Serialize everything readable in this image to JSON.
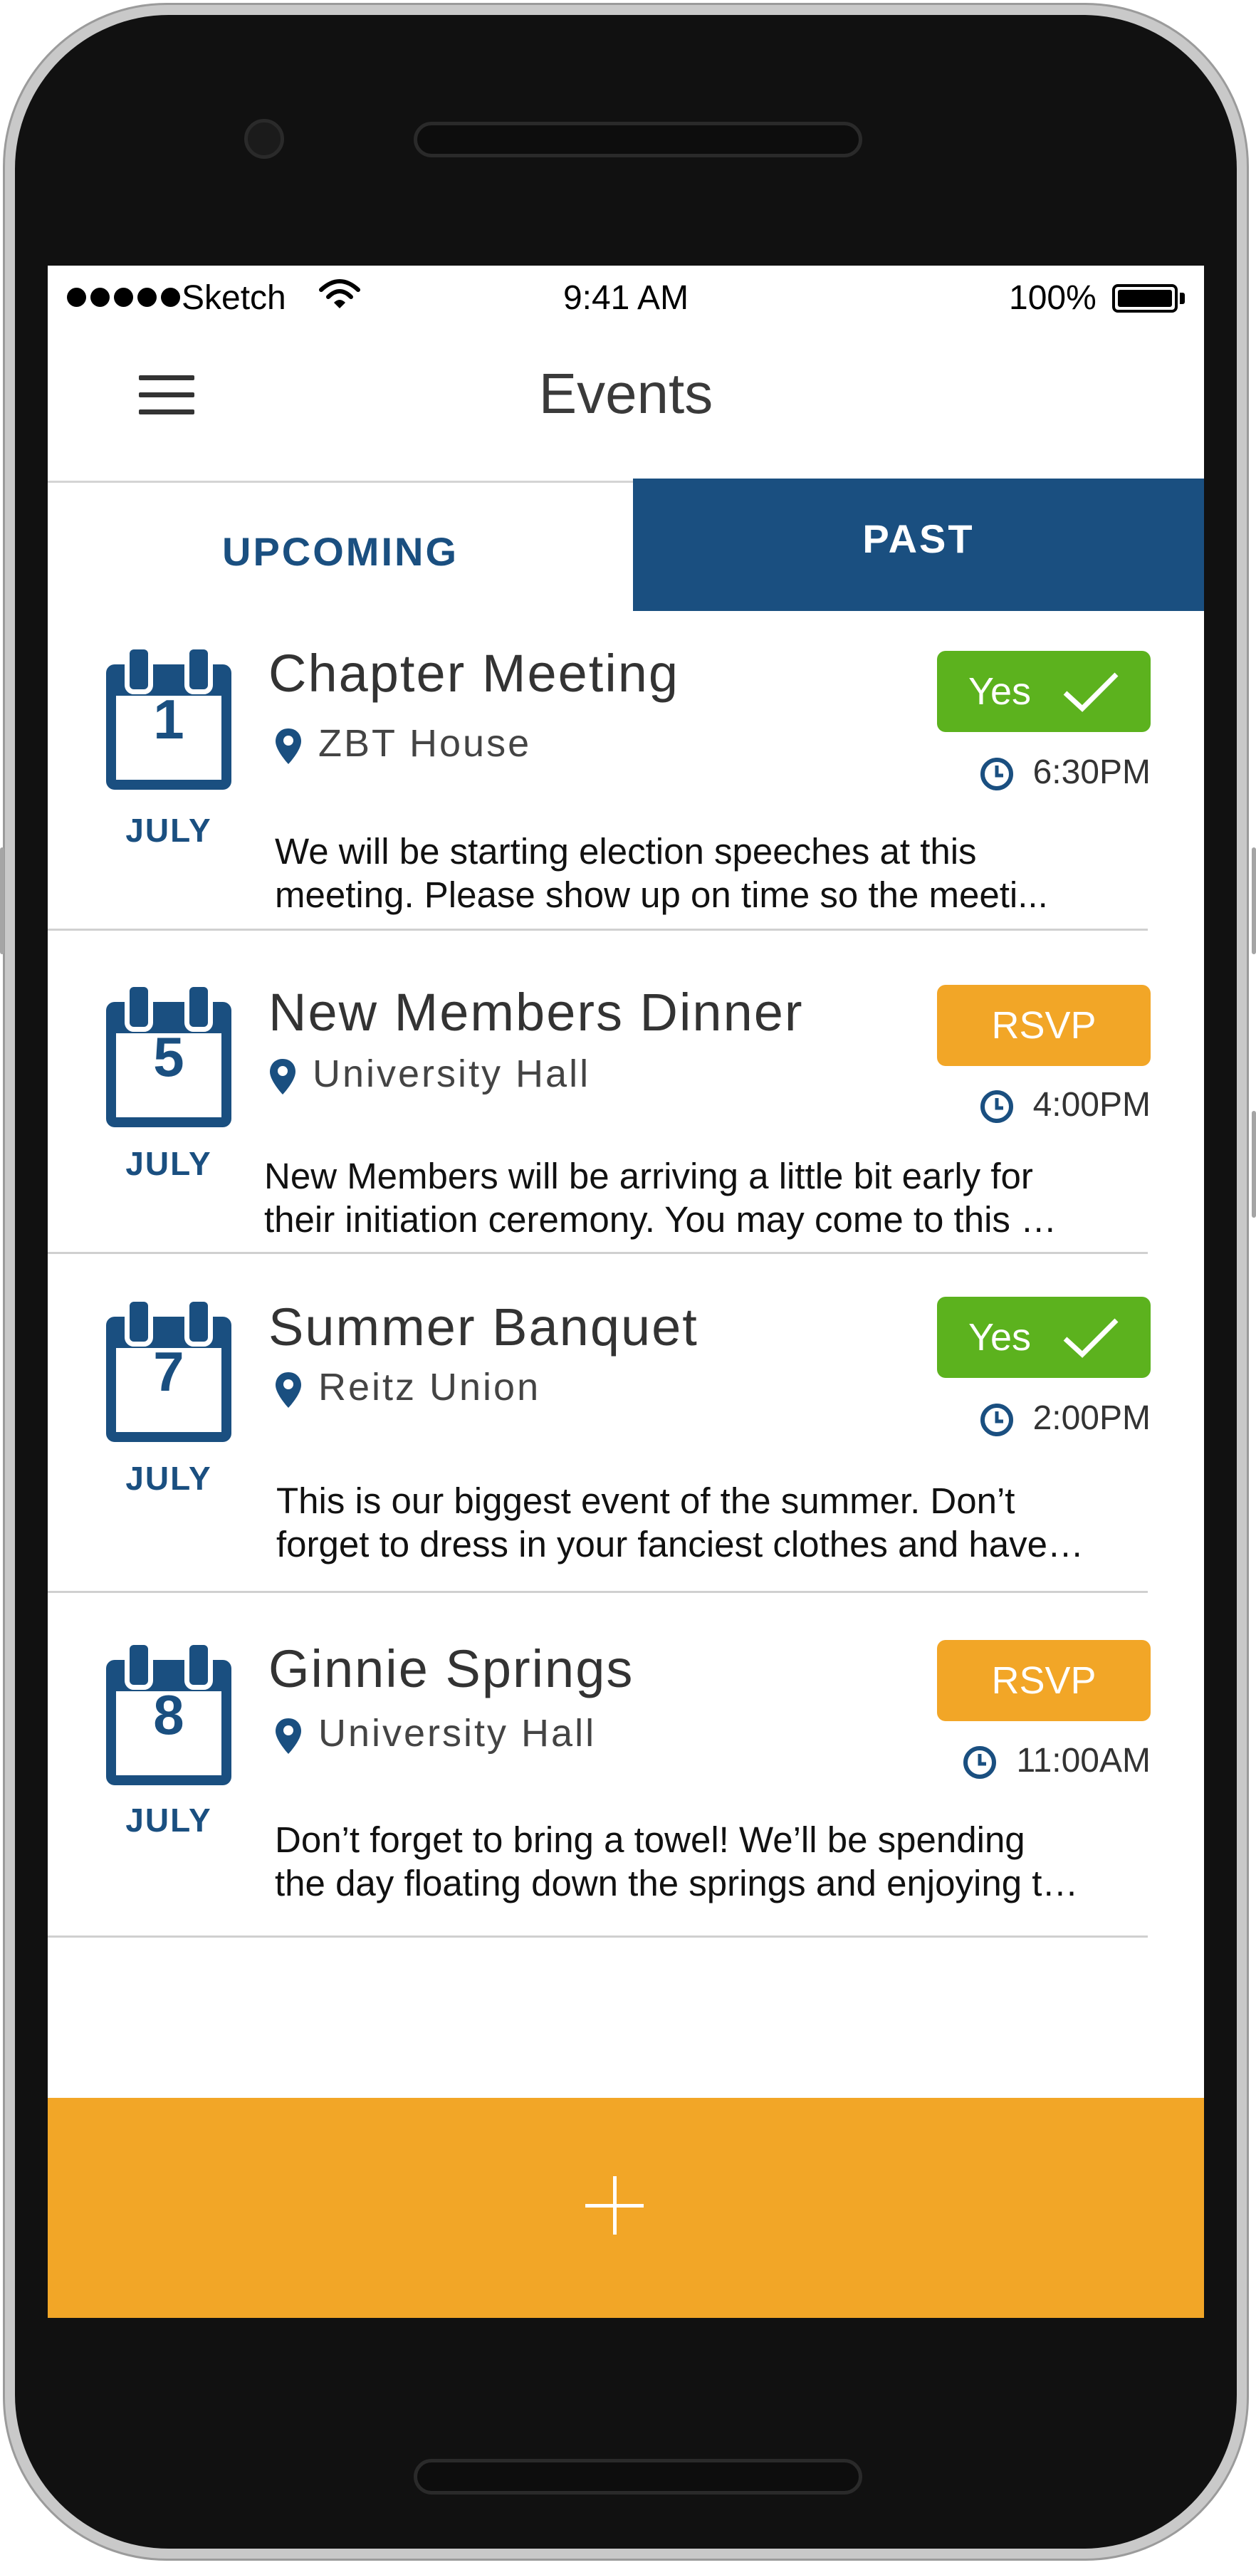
{
  "status_bar": {
    "carrier": "Sketch",
    "time": "9:41 AM",
    "battery": "100%"
  },
  "nav": {
    "title": "Events"
  },
  "tabs": [
    {
      "label": "UPCOMING"
    },
    {
      "label": "PAST"
    }
  ],
  "events": [
    {
      "day": "1",
      "month": "JULY",
      "title": "Chapter Meeting",
      "location": "ZBT House",
      "status": "Yes",
      "time": "6:30PM",
      "description_line1": "We will be starting election speeches at this",
      "description_line2": "meeting.  Please show up on time so the meeti..."
    },
    {
      "day": "5",
      "month": "JULY",
      "title": "New Members Dinner",
      "location": "University Hall",
      "status": "RSVP",
      "time": "4:00PM",
      "description_line1": "New Members will be arriving a little bit early for",
      "description_line2": "their initiation ceremony.  You may come to this …"
    },
    {
      "day": "7",
      "month": "JULY",
      "title": "Summer Banquet",
      "location": "Reitz Union",
      "status": "Yes",
      "time": "2:00PM",
      "description_line1": "This is our biggest event of the summer.  Don’t",
      "description_line2": "forget to dress in your fanciest clothes and have…"
    },
    {
      "day": "8",
      "month": "JULY",
      "title": "Ginnie Springs",
      "location": "University Hall",
      "status": "RSVP",
      "time": "11:00AM",
      "description_line1": "Don’t forget to bring a towel!  We’ll be spending",
      "description_line2": "the day floating down the springs and enjoying t…"
    }
  ],
  "colors": {
    "primary": "#1a4f80",
    "yes": "#5cb21e",
    "rsvp": "#f2a627",
    "fab_bar": "#f2a627"
  },
  "icons": {
    "menu": "hamburger-menu-icon",
    "calendar": "calendar-icon",
    "location": "location-pin-icon",
    "clock": "clock-icon",
    "check": "checkmark-icon",
    "add": "plus-icon"
  }
}
